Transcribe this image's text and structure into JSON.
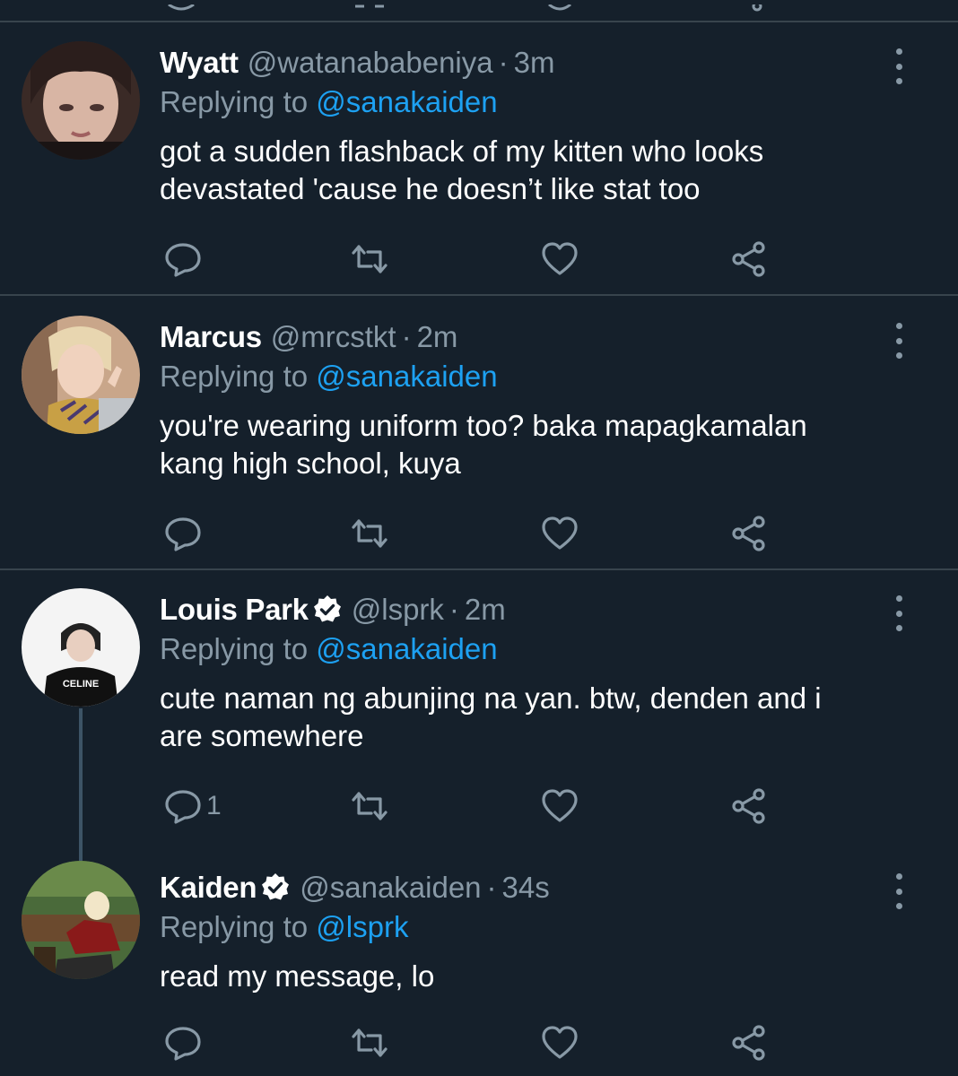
{
  "tweets": [
    {
      "name": "Wyatt",
      "verified": false,
      "handle": "@watanababeniya",
      "separator": "·",
      "time": "3m",
      "replying_prefix": "Replying to",
      "replying_to": "@sanakaiden",
      "text": "got a sudden flashback of my kitten who looks\ndevastated 'cause he doesn’t like stat too",
      "reply_count": ""
    },
    {
      "name": "Marcus",
      "verified": false,
      "handle": "@mrcstkt",
      "separator": "·",
      "time": "2m",
      "replying_prefix": "Replying to",
      "replying_to": "@sanakaiden",
      "text": "you're wearing uniform too? baka mapagkamalan\nkang high school, kuya",
      "reply_count": ""
    },
    {
      "name": "Louis Park",
      "verified": true,
      "handle": "@lsprk",
      "separator": "·",
      "time": "2m",
      "replying_prefix": "Replying to",
      "replying_to": "@sanakaiden",
      "text": "cute naman ng abunjing na yan. btw, denden and i\nare somewhere",
      "reply_count": "1",
      "avatar_text": "CELINE"
    },
    {
      "name": "Kaiden",
      "verified": true,
      "handle": "@sanakaiden",
      "separator": "·",
      "time": "34s",
      "replying_prefix": "Replying to",
      "replying_to": "@lsprk",
      "text": "read my message, lo",
      "reply_count": ""
    }
  ],
  "icons": {
    "reply": "reply-icon",
    "retweet": "retweet-icon",
    "like": "heart-icon",
    "share": "share-icon",
    "more": "more-vertical-icon",
    "verified": "verified-badge-icon"
  },
  "colors": {
    "background": "#15202b",
    "divider": "#38444d",
    "secondary_text": "#8899a6",
    "link": "#1da1f2"
  }
}
